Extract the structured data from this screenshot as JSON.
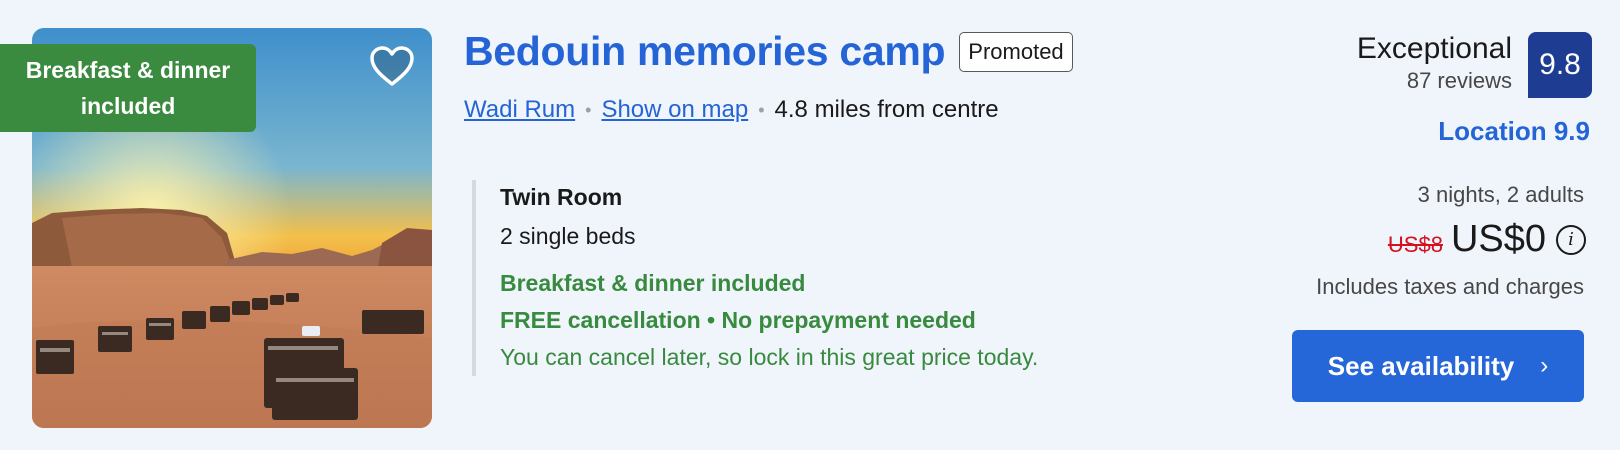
{
  "property": {
    "title": "Bedouin memories camp",
    "promoted_label": "Promoted",
    "photo_badge": "Breakfast & dinner included",
    "location_link": "Wadi Rum",
    "map_link": "Show on map",
    "separator": "•",
    "distance": "4.8 miles from centre"
  },
  "room": {
    "name": "Twin Room",
    "beds": "2 single beds",
    "meal": "Breakfast & dinner included",
    "cancellation": "FREE cancellation • No prepayment needed",
    "note": "You can cancel later, so lock in this great price today."
  },
  "review": {
    "label": "Exceptional",
    "count": "87 reviews",
    "score": "9.8",
    "location_score": "Location 9.9"
  },
  "pricing": {
    "stay": "3 nights, 2 adults",
    "old_price": "US$8",
    "price": "US$0",
    "taxes": "Includes taxes and charges",
    "info_icon": "i"
  },
  "actions": {
    "availability_label": "See availability",
    "chevron": "›"
  },
  "colors": {
    "accent": "#2464d6",
    "score_bg": "#1f3c93",
    "green": "#378a3e",
    "strike_red": "#d4111e"
  },
  "icons": {
    "favorite": "heart-icon",
    "info": "info-icon",
    "chevron": "chevron-right-icon"
  }
}
